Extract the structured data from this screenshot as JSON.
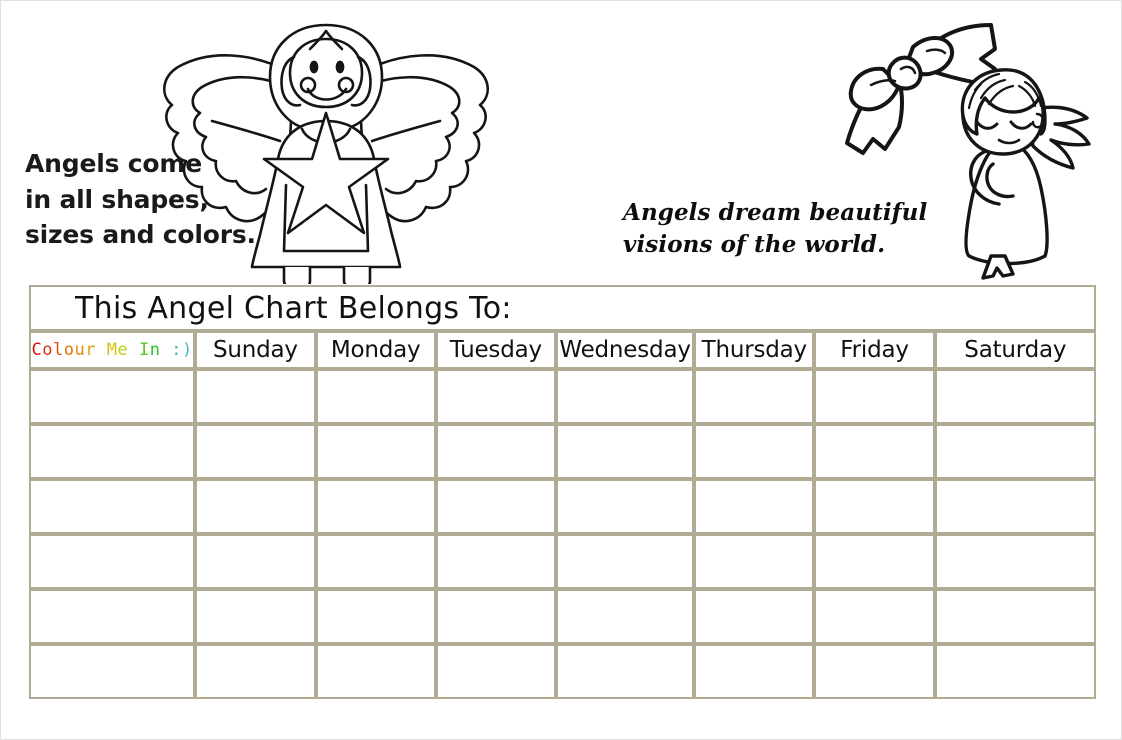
{
  "page": {
    "title": "Angel Chart"
  },
  "art": {
    "quote_left": "Angels come\nin all shapes,\nsizes and colors.",
    "quote_right": "Angels dream beautiful\nvisions of the world.",
    "angel_main_alt": "large line-art angel with wings, halo hair and star dress",
    "angel_cherub_alt": "small cherub angel with closed eyes and wings",
    "ribbon_alt": "decorative ribbon bow"
  },
  "chart": {
    "title": "This Angel Chart Belongs To:",
    "colour_me_in": {
      "text": "Colour Me In :)",
      "letters": [
        {
          "ch": "C",
          "color": "#d41212"
        },
        {
          "ch": "o",
          "color": "#d8340c"
        },
        {
          "ch": "l",
          "color": "#dc5409"
        },
        {
          "ch": "o",
          "color": "#e07406"
        },
        {
          "ch": "u",
          "color": "#e28c05"
        },
        {
          "ch": "r",
          "color": "#e2a204"
        },
        {
          "ch": " ",
          "color": "#e2a204"
        },
        {
          "ch": "M",
          "color": "#d8c209"
        },
        {
          "ch": "e",
          "color": "#bcd00d"
        },
        {
          "ch": " ",
          "color": "#bcd00d"
        },
        {
          "ch": "I",
          "color": "#5fc61a"
        },
        {
          "ch": "n",
          "color": "#2fc22a"
        },
        {
          "ch": " ",
          "color": "#2fc22a"
        },
        {
          "ch": ":",
          "color": "#2cbfa0"
        },
        {
          "ch": ")",
          "color": "#4ab9c8"
        }
      ]
    },
    "days": [
      "Sunday",
      "Monday",
      "Tuesday",
      "Wednesday",
      "Thursday",
      "Friday",
      "Saturday"
    ],
    "body_rows": 6,
    "grid_color": "#b0ab92",
    "page_border_color": "#e0e0e0"
  }
}
